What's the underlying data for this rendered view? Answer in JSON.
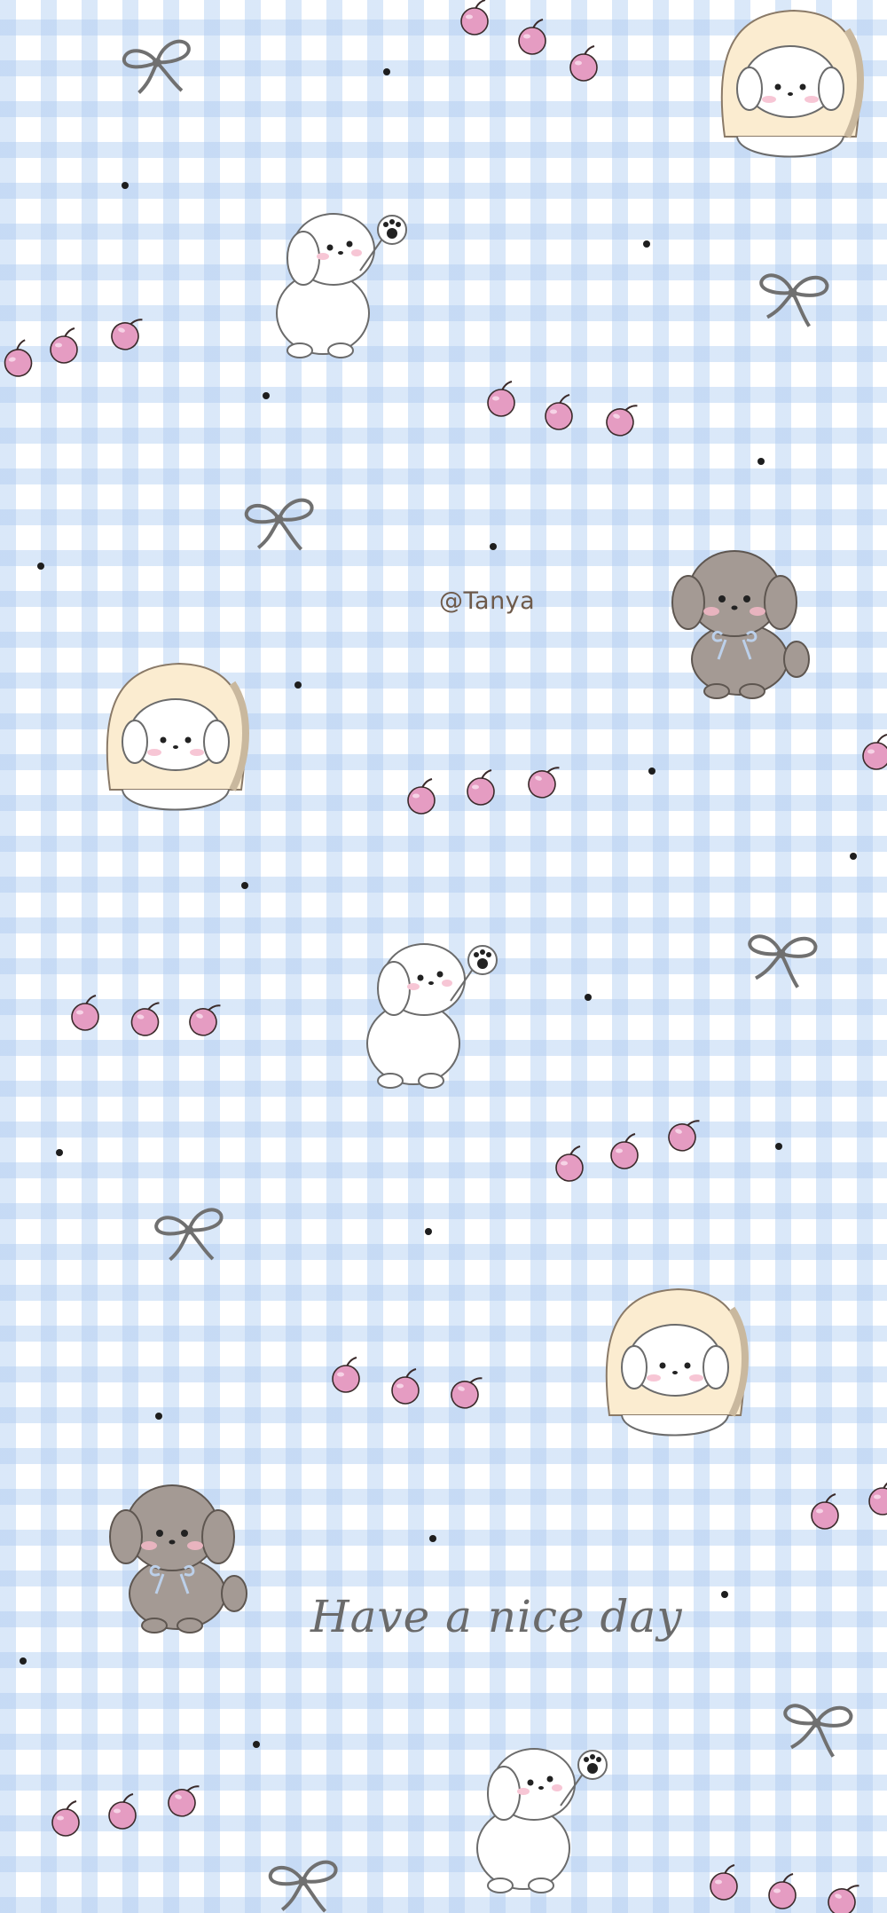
{
  "watermark": "@Tanya",
  "greeting": "Have a nice day",
  "colors": {
    "gingham": "#a8c8f0",
    "cherry": "#e59cc2",
    "cherry_outline": "#3a2a2a",
    "bow": "#707070",
    "bread": "#fbecd0",
    "dog_white": "#ffffff",
    "dog_grey": "#a49a94",
    "text": "#6a6a6a"
  },
  "icons": [
    "cherry-icon",
    "bow-icon",
    "dot-icon",
    "white-puppy-waving",
    "puppy-in-toast",
    "grey-puppy-with-ribbon"
  ]
}
